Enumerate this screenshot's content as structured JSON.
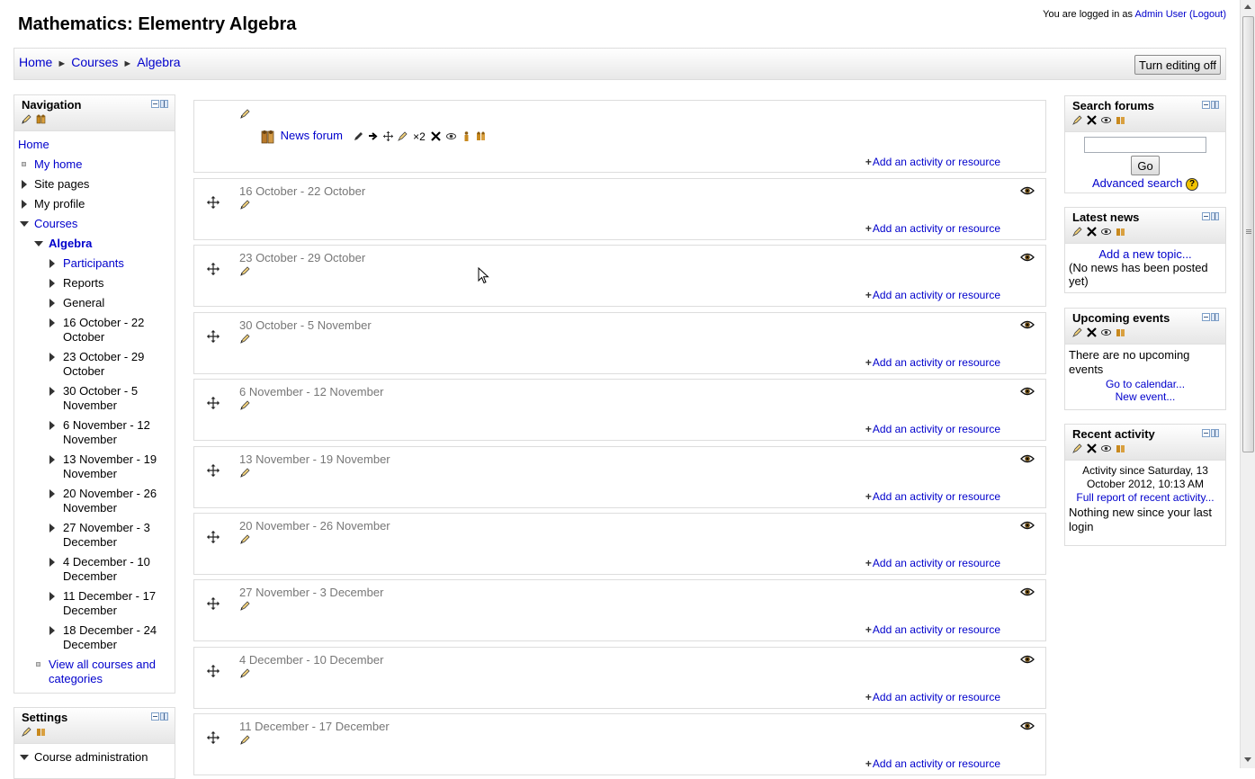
{
  "page": {
    "title": "Mathematics: Elementry Algebra",
    "login_prefix": "You are logged in as",
    "login_user": "Admin User",
    "logout_label": "(Logout)"
  },
  "breadcrumb": [
    "Home",
    "Courses",
    "Algebra"
  ],
  "breadcrumb_sep": "►",
  "toolbar": {
    "edit_button": "Turn editing off"
  },
  "navigation": {
    "title": "Navigation",
    "home": "Home",
    "my_home": "My home",
    "site_pages": "Site pages",
    "my_profile": "My profile",
    "courses": "Courses",
    "course": "Algebra",
    "course_items": [
      "Participants",
      "Reports",
      "General",
      "16 October - 22 October",
      "23 October - 29 October",
      "30 October - 5 November",
      "6 November - 12 November",
      "13 November - 19 November",
      "20 November - 26 November",
      "27 November - 3 December",
      "4 December - 10 December",
      "11 December - 17 December",
      "18 December - 24 December"
    ],
    "view_all": "View all courses and categories"
  },
  "settings": {
    "title": "Settings",
    "course_admin": "Course administration"
  },
  "news_forum": {
    "label": "News forum",
    "group_label": "×2"
  },
  "add_activity_label": "Add an activity or resource",
  "sections": [
    "16 October - 22 October",
    "23 October - 29 October",
    "30 October - 5 November",
    "6 November - 12 November",
    "13 November - 19 November",
    "20 November - 26 November",
    "27 November - 3 December",
    "4 December - 10 December",
    "11 December - 17 December"
  ],
  "search_forums": {
    "title": "Search forums",
    "input_value": "",
    "go_button": "Go",
    "advanced": "Advanced search",
    "help_icon": "?"
  },
  "latest_news": {
    "title": "Latest news",
    "add_topic": "Add a new topic...",
    "empty": "(No news has been posted yet)"
  },
  "upcoming": {
    "title": "Upcoming events",
    "empty": "There are no upcoming events",
    "calendar_link": "Go to calendar...",
    "new_event": "New event..."
  },
  "recent": {
    "title": "Recent activity",
    "since": "Activity since Saturday, 13 October 2012, 10:13 AM",
    "full_report": "Full report of recent activity...",
    "nothing": "Nothing new since your last login"
  },
  "icons": {
    "edit": "pencil-hand-icon",
    "assign_roles": "assign-roles-icon",
    "move": "move-icon",
    "hide": "eye-icon",
    "delete": "delete-icon",
    "arrow": "right-arrow-icon"
  },
  "colors": {
    "link": "#0000cc",
    "section_title": "#777777",
    "block_border": "#dddddd"
  }
}
